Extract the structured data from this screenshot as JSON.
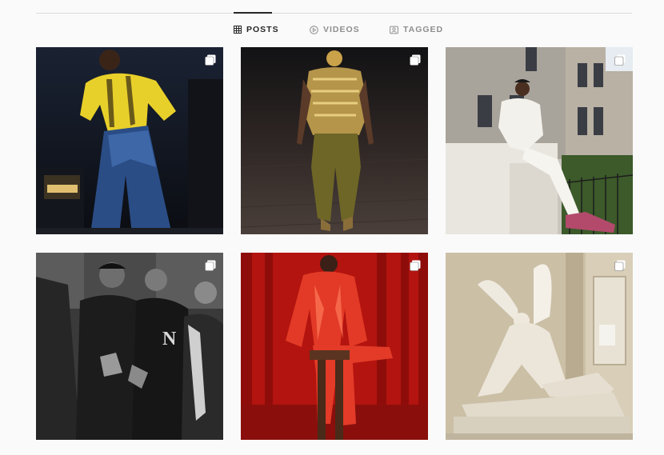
{
  "tabs": [
    {
      "label": "POSTS",
      "icon": "grid-icon",
      "active": true
    },
    {
      "label": "VIDEOS",
      "icon": "play-circle-icon",
      "active": false
    },
    {
      "label": "TAGGED",
      "icon": "tag-portrait-icon",
      "active": false
    }
  ],
  "grid": {
    "posts": [
      {
        "description": "Model in yellow sweater and wide blue jeans at night",
        "badge": "multi-image-icon"
      },
      {
        "description": "Runway model in gold armor top and olive trousers",
        "badge": "multi-image-icon"
      },
      {
        "description": "Man in white outfit sitting on stone wall, townhouse street",
        "badge": "multi-image-icon"
      },
      {
        "description": "Black and white group photo of young men in varsity jackets",
        "badge": "multi-image-icon"
      },
      {
        "description": "Model in glossy red latex suit on stool against red curtains",
        "badge": "multi-image-icon"
      },
      {
        "description": "Marble sculpture of Psyche revived by Cupid's kiss",
        "badge": "multi-image-icon"
      }
    ]
  },
  "colors": {
    "background": "#fafafa",
    "divider": "#dbdbdb",
    "text_active": "#262626",
    "text_inactive": "#8e8e8e"
  }
}
